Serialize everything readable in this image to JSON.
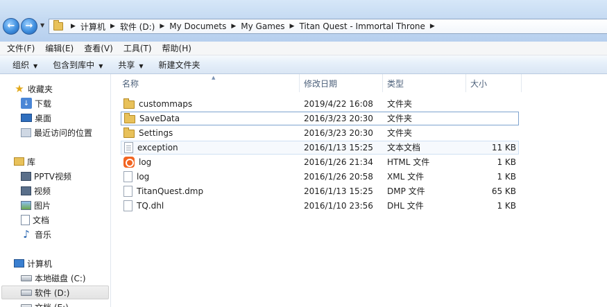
{
  "address": {
    "crumbs": [
      "计算机",
      "软件 (D:)",
      "My Documets",
      "My Games",
      "Titan Quest - Immortal Throne"
    ]
  },
  "menubar": {
    "items": [
      "文件(F)",
      "编辑(E)",
      "查看(V)",
      "工具(T)",
      "帮助(H)"
    ]
  },
  "cmdbar": {
    "organize": "组织",
    "include_library": "包含到库中",
    "share": "共享",
    "new_folder": "新建文件夹"
  },
  "nav": {
    "favorites": "收藏夹",
    "downloads": "下载",
    "desktop": "桌面",
    "recent": "最近访问的位置",
    "libraries": "库",
    "pptv": "PPTV视频",
    "videos": "视频",
    "pictures": "图片",
    "documents": "文档",
    "music": "音乐",
    "computer": "计算机",
    "local_disk": "本地磁盘 (C:)",
    "software_disk": "软件 (D:)",
    "doc_disk": "文档 (E:)"
  },
  "columns": {
    "name": "名称",
    "modified": "修改日期",
    "type": "类型",
    "size": "大小"
  },
  "files": [
    {
      "name": "custommaps",
      "date": "2019/4/22 16:08",
      "type": "文件夹",
      "size": "",
      "icon": "folder-icon"
    },
    {
      "name": "SaveData",
      "date": "2016/3/23 20:30",
      "type": "文件夹",
      "size": "",
      "icon": "folder-icon"
    },
    {
      "name": "Settings",
      "date": "2016/3/23 20:30",
      "type": "文件夹",
      "size": "",
      "icon": "folder-icon"
    },
    {
      "name": "exception",
      "date": "2016/1/13 15:25",
      "type": "文本文档",
      "size": "11 KB",
      "icon": "text-file-icon"
    },
    {
      "name": "log",
      "date": "2016/1/26 21:34",
      "type": "HTML 文件",
      "size": "1 KB",
      "icon": "html-file-icon"
    },
    {
      "name": "log",
      "date": "2016/1/26 20:58",
      "type": "XML 文件",
      "size": "1 KB",
      "icon": "file-icon"
    },
    {
      "name": "TitanQuest.dmp",
      "date": "2016/1/13 15:25",
      "type": "DMP 文件",
      "size": "65 KB",
      "icon": "file-icon"
    },
    {
      "name": "TQ.dhl",
      "date": "2016/1/10 23:56",
      "type": "DHL 文件",
      "size": "1 KB",
      "icon": "file-icon"
    }
  ]
}
